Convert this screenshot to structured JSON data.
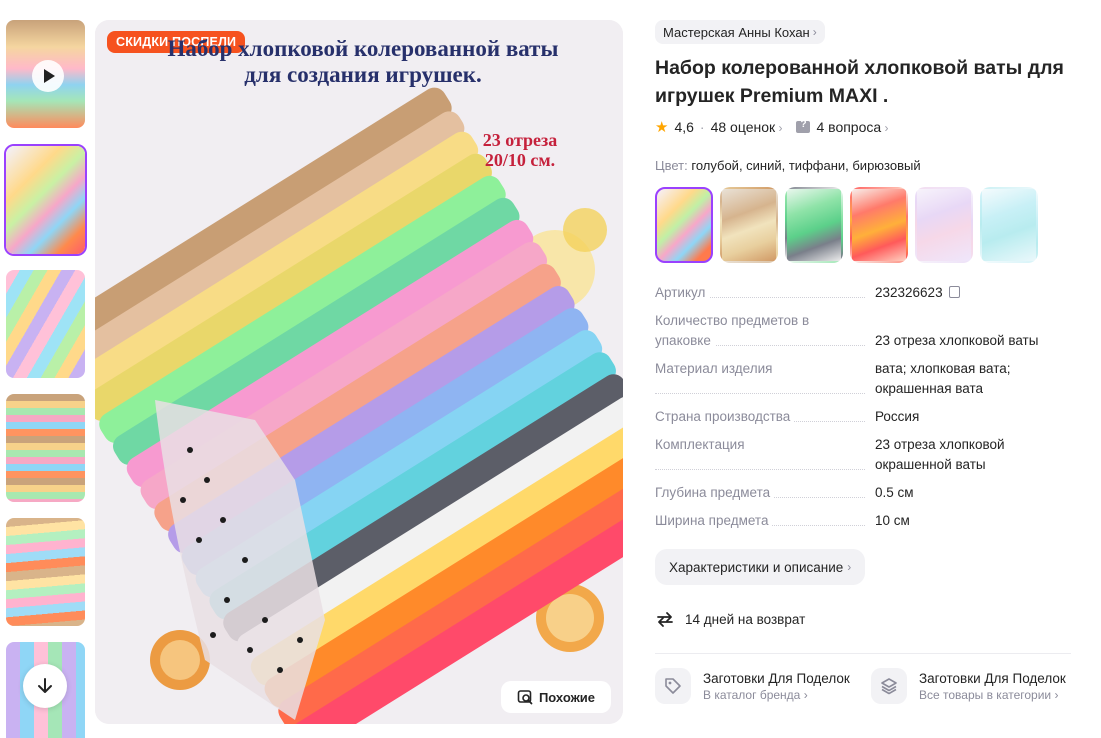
{
  "gallery": {
    "sale_badge": "СКИДКИ ПОСПЕЛИ",
    "image_title": "Набор хлопковой колерованной ваты для создания игрушек.",
    "image_subtitle_line1": "23 отреза",
    "image_subtitle_line2": "20/10 см.",
    "similar_label": "Похожие"
  },
  "product": {
    "brand": "Мастерская Анны Кохан",
    "title": "Набор колерованной хлопковой ваты для игрушек Premium MAXI .",
    "rating": "4,6",
    "reviews": "48 оценок",
    "questions": "4 вопроса",
    "color_label": "Цвет:",
    "color_value": "голубой, синий, тиффани, бирюзовый"
  },
  "specs": [
    {
      "k": "Артикул",
      "v": "232326623"
    },
    {
      "k": "Количество предметов в упаковке",
      "v": "23 отреза хлопковой ваты"
    },
    {
      "k": "Материал изделия",
      "v": "вата; хлопковая вата; окрашенная вата"
    },
    {
      "k": "Страна производства",
      "v": "Россия"
    },
    {
      "k": "Комплектация",
      "v": "23 отреза хлопковой окрашенной ваты"
    },
    {
      "k": "Глубина предмета",
      "v": "0.5 см"
    },
    {
      "k": "Ширина предмета",
      "v": "10 см"
    }
  ],
  "actions": {
    "characteristics": "Характеристики и описание",
    "returns": "14 дней на возврат"
  },
  "links": [
    {
      "title": "Заготовки Для Поделок",
      "sub": "В каталог бренда"
    },
    {
      "title": "Заготовки Для Поделок",
      "sub": "Все товары в категории"
    }
  ],
  "colors": {
    "accent": "#9a41fe",
    "sale": "#f6521f",
    "star": "#ffa500"
  }
}
